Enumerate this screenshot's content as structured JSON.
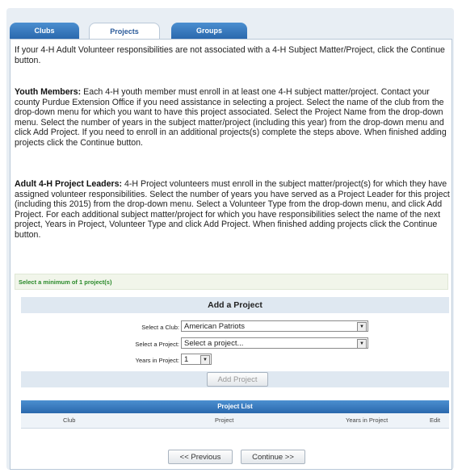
{
  "tabs": {
    "clubs": "Clubs",
    "projects": "Projects",
    "groups": "Groups"
  },
  "intro": "If your 4-H Adult Volunteer responsibilities are not associated with a 4-H Subject Matter/Project, click the Continue button.",
  "youth": {
    "heading": "Youth Members:",
    "body": "Each 4-H youth member must enroll in at least one 4-H subject matter/project.  Contact your county Purdue Extension Office if you need assistance in selecting a project.  Select the name of the club from the drop-down menu for which you want to have this project associated.  Select the Project Name from the drop-down menu.  Select the number of years in the subject matter/project (including this year)  from the drop-down menu and click Add Project.  If you need to enroll in an additional projects(s) complete the steps above.  When finished adding projects click the Continue button."
  },
  "adult": {
    "heading": "Adult 4-H Project Leaders:",
    "body": "4-H Project volunteers must enroll in the subject matter/project(s) for which they have assigned volunteer responsibilities. Select the number of years you have served as a Project Leader for this project (including this 2015) from the drop-down menu. Select a Volunteer Type from the drop-down menu, and click Add Project.  For each additional subject matter/project for which you have responsibilities select the name of the next project, Years in Project, Volunteer Type and click Add Project. When finished adding projects click the Continue button."
  },
  "notice": "Select a minimum of 1 project(s)",
  "add_project": {
    "title": "Add a Project",
    "club_label": "Select a Club:",
    "club_value": "American Patriots",
    "project_label": "Select a Project:",
    "project_value": "Select a project...",
    "years_label": "Years in Project:",
    "years_value": "1",
    "button": "Add Project"
  },
  "project_list": {
    "title": "Project List",
    "columns": [
      "Club",
      "Project",
      "Years in Project",
      "Edit"
    ]
  },
  "nav": {
    "previous": "<< Previous",
    "continue": "Continue >>"
  }
}
